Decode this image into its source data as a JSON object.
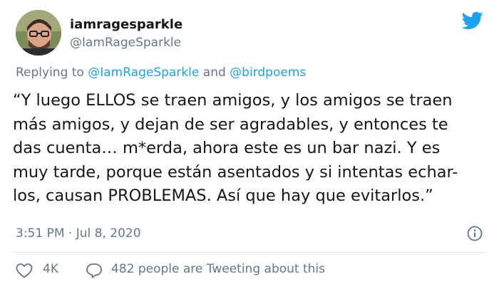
{
  "author": {
    "display_name": "iamragesparkle",
    "handle": "@IamRageSparkle",
    "avatar_icon": "avatar-photo"
  },
  "reply": {
    "prefix": "Replying to ",
    "mention1": "@IamRageSparkle",
    "connector": " and ",
    "mention2": "@birdpoems"
  },
  "tweet": {
    "lines": [
      "“Y luego ELLOS se traen amigos, y los amigos se traen",
      "más amigos, y dejan de ser agradables, y entonces te",
      "das cuenta… m*erda, ahora este es un bar nazi. Y es",
      "muy tarde, porque están asentados y si intentas echar-",
      "los, causan PROBLEMAS. Así que hay que evitarlos.”"
    ]
  },
  "meta": {
    "timestamp": "3:51 PM · Jul 8, 2020"
  },
  "actions": {
    "like_count": "4K",
    "tweeting": "482 people are Tweeting about this"
  },
  "colors": {
    "brand": "#1da1f2",
    "secondary_text": "#657786",
    "primary_text": "#14171a",
    "divider": "#e1e8ed"
  },
  "icons": {
    "brand": "twitter-bird-icon",
    "info": "info-icon",
    "like": "heart-icon",
    "reply": "comment-icon"
  }
}
